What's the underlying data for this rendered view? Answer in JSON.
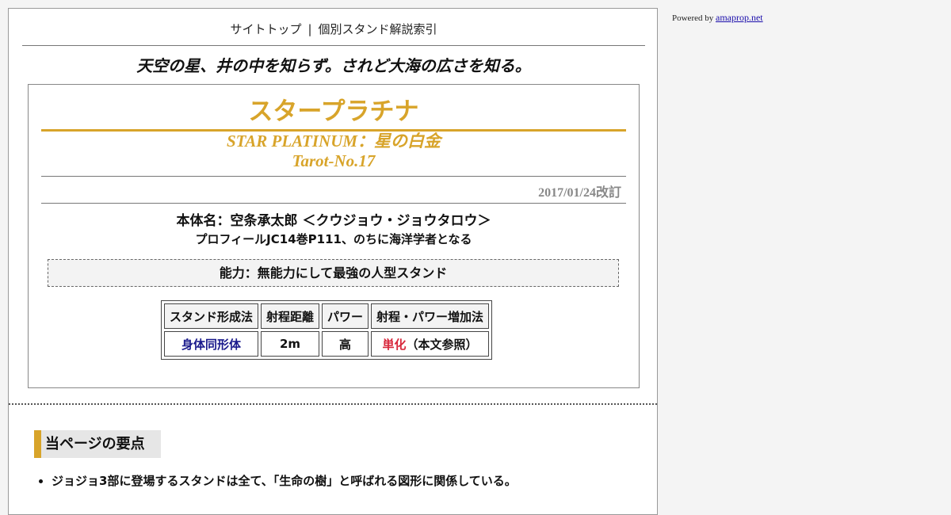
{
  "nav": {
    "top_label": "サイトトップ",
    "separator": "|",
    "index_label": "個別スタンド解説索引"
  },
  "tagline": "天空の星、井の中を知らず。されど大海の広さを知る。",
  "stand": {
    "name_jp": "スタープラチナ",
    "name_en": "STAR PLATINUM：星の白金",
    "tarot": "Tarot-No.17",
    "revised": "2017/01/24改訂",
    "user": "本体名：空条承太郎 ＜クウジョウ・ジョウタロウ＞",
    "profile": "プロフィールJC14巻P111、のちに海洋学者となる",
    "ability": "能力：無能力にして最強の人型スタンド"
  },
  "specs": {
    "headers": [
      "スタンド形成法",
      "射程距離",
      "パワー",
      "射程・パワー増加法"
    ],
    "formation": "身体同形体",
    "range": "2m",
    "power": "高",
    "increase_highlight": "単化",
    "increase_note": "（本文参照）"
  },
  "summary": {
    "heading": "当ページの要点",
    "items": [
      "ジョジョ3部に登場するスタンドは全て、「生命の樹」と呼ばれる図形に関係している。"
    ]
  },
  "sidebar": {
    "powered_prefix": "Powered by",
    "powered_link": "amaprop.net"
  },
  "colors": {
    "accent_gold": "#d8a42a",
    "blue_text": "#1a1a8c",
    "red_text": "#d8283c"
  }
}
